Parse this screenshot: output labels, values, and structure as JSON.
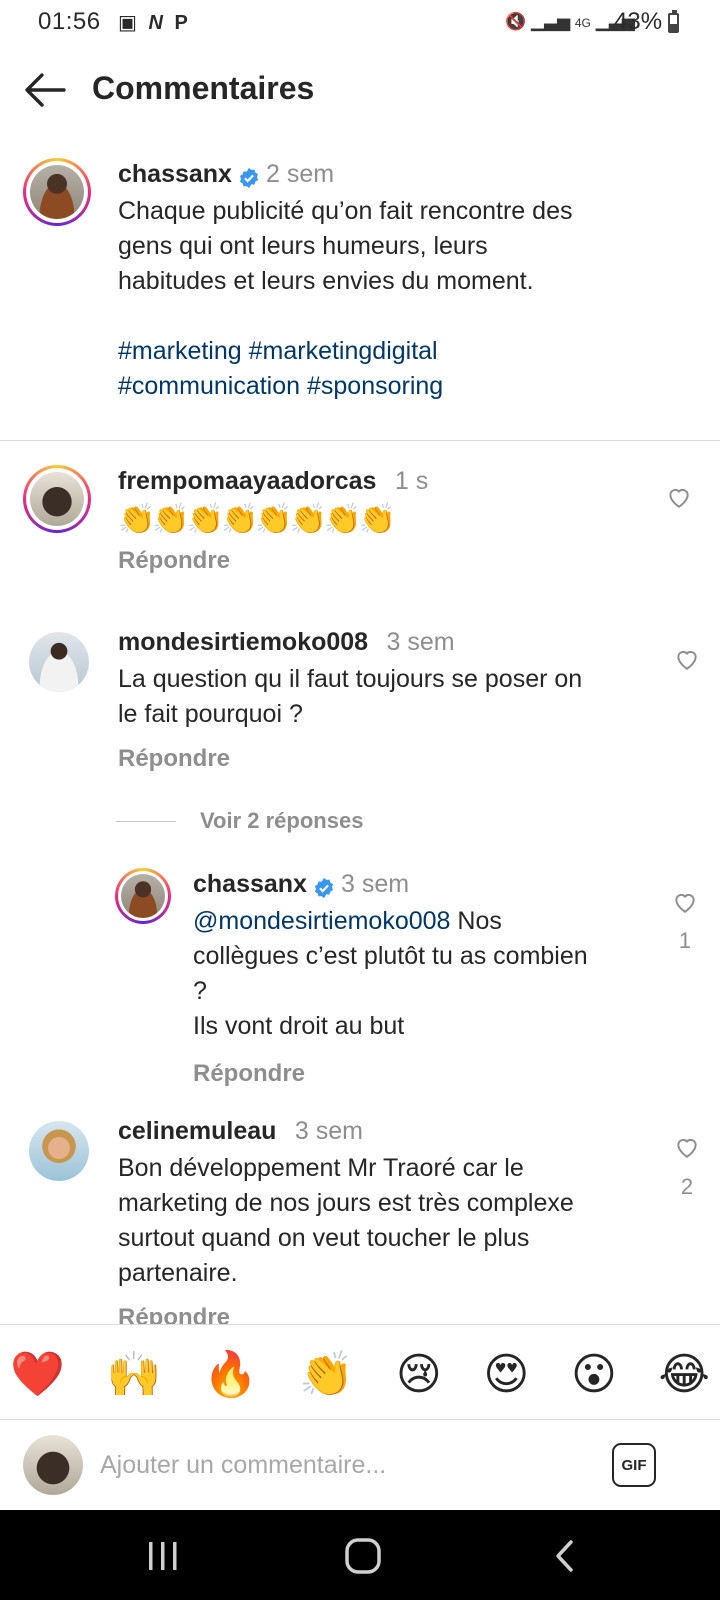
{
  "status_bar": {
    "time": "01:56",
    "left_icons": [
      "image-icon",
      "nfc-icon",
      "parking-icon"
    ],
    "network": "4G",
    "battery_percent": "43%",
    "battery_level": 0.43
  },
  "header": {
    "title": "Commentaires",
    "back_icon": "arrow-left-icon"
  },
  "post": {
    "username": "chassanx",
    "verified": true,
    "time": "2 sem",
    "lines": [
      "Chaque publicité qu’on fait rencontre des",
      "gens qui ont leurs humeurs, leurs",
      "habitudes et leurs envies du moment."
    ],
    "hashtags_line1": "#marketing #marketingdigital",
    "hashtags_line2": "#communication #sponsoring"
  },
  "comments": [
    {
      "username": "frempomaayaadorcas",
      "time": "1 s",
      "text": "👏👏👏👏👏👏👏👏",
      "reply": "Répondre"
    },
    {
      "username": "mondesirtiemoko008",
      "time": "3 sem",
      "lines": [
        "La question qu il faut toujours se poser on",
        "le fait pourquoi ?"
      ],
      "reply": "Répondre",
      "view_replies": "Voir 2 réponses"
    },
    {
      "username": "chassanx",
      "verified": true,
      "time": "3 sem",
      "mention": "@mondesirtiemoko008",
      "line1_rest": " Nos",
      "lines": [
        "collègues c’est plutôt tu as combien",
        "?",
        "Ils vont droit au but"
      ],
      "reply": "Répondre",
      "likes": "1"
    },
    {
      "username": "celinemuleau",
      "time": "3 sem",
      "lines": [
        "Bon développement Mr Traoré car le",
        "marketing de nos jours est très complexe",
        "surtout quand on veut toucher le plus",
        "partenaire."
      ],
      "reply": "Répondre",
      "likes": "2"
    }
  ],
  "reactions": [
    "❤️",
    "🙌",
    "🔥",
    "👏",
    "😢",
    "😍",
    "😮",
    "😂"
  ],
  "composer": {
    "placeholder": "Ajouter un commentaire...",
    "gif_label": "GIF"
  },
  "colors": {
    "hashtag": "#00376b",
    "verified": "#3897f0",
    "muted": "#8e8e8e"
  }
}
